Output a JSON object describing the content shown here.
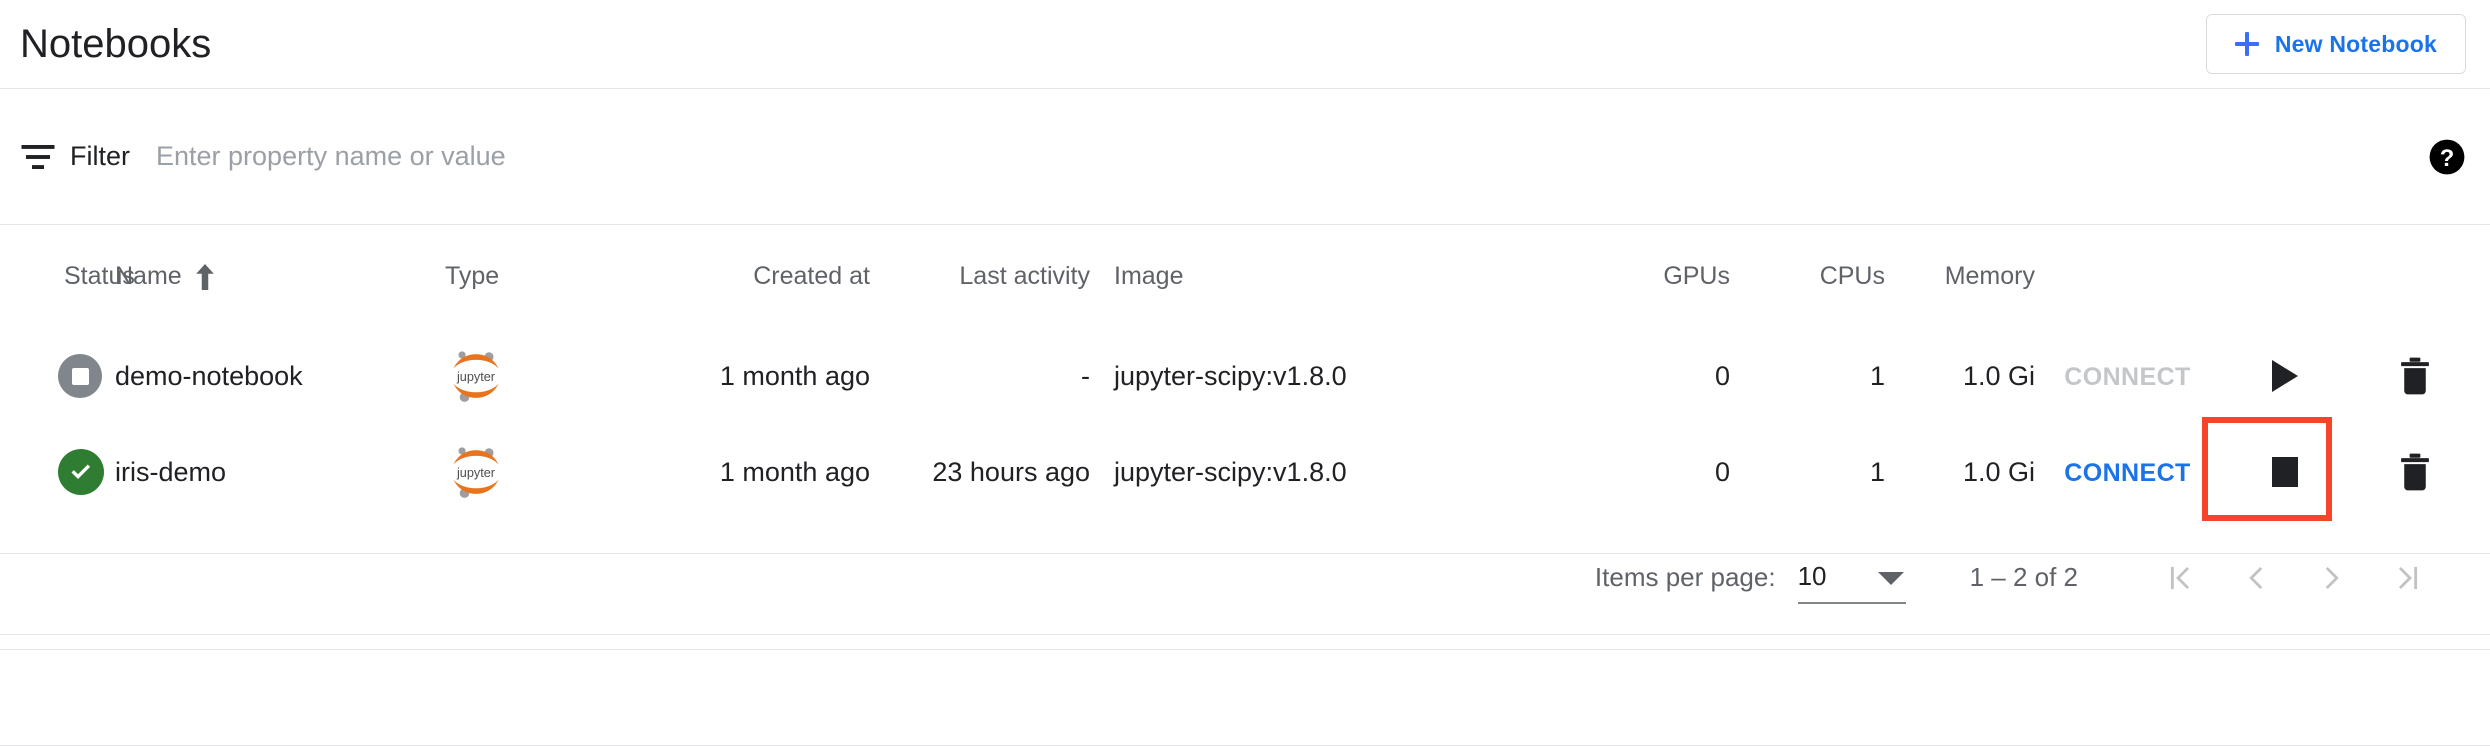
{
  "header": {
    "title": "Notebooks",
    "new_notebook_label": "New Notebook"
  },
  "filter": {
    "label": "Filter",
    "placeholder": "Enter property name or value",
    "value": ""
  },
  "table": {
    "columns": [
      "Status",
      "Name",
      "Type",
      "Created at",
      "Last activity",
      "Image",
      "GPUs",
      "CPUs",
      "Memory"
    ],
    "sort": {
      "column": "Name",
      "direction": "ascending"
    },
    "rows": [
      {
        "status": "stopped",
        "name": "demo-notebook",
        "type": "jupyter",
        "created_at": "1 month ago",
        "last_activity": "-",
        "image": "jupyter-scipy:v1.8.0",
        "gpus": "0",
        "cpus": "1",
        "memory": "1.0 Gi",
        "connect_label": "CONNECT",
        "connect_enabled": false,
        "action": "start"
      },
      {
        "status": "running",
        "name": "iris-demo",
        "type": "jupyter",
        "created_at": "1 month ago",
        "last_activity": "23 hours ago",
        "image": "jupyter-scipy:v1.8.0",
        "gpus": "0",
        "cpus": "1",
        "memory": "1.0 Gi",
        "connect_label": "CONNECT",
        "connect_enabled": true,
        "action": "stop"
      }
    ]
  },
  "paginator": {
    "items_per_page_label": "Items per page:",
    "items_per_page_value": "10",
    "range_label": "1 – 2 of 2"
  },
  "colors": {
    "accent_blue": "#1a73e8",
    "button_blue": "#3d6ef5",
    "running_green": "#2f7d32",
    "stopped_gray": "#80868b",
    "highlight_red": "#f4452a",
    "jupyter_orange": "#e8741e",
    "disabled_gray": "#c4c7c9"
  },
  "icons": {
    "plus": "plus-icon",
    "filter": "filter-icon",
    "help": "help-icon",
    "sort_arrow": "sort-arrow-up-icon",
    "jupyter": "jupyter-logo-icon",
    "start": "play-icon",
    "stop": "stop-icon",
    "delete": "trash-icon",
    "first_page": "first-page-icon",
    "prev_page": "previous-page-icon",
    "next_page": "next-page-icon",
    "last_page": "last-page-icon"
  }
}
